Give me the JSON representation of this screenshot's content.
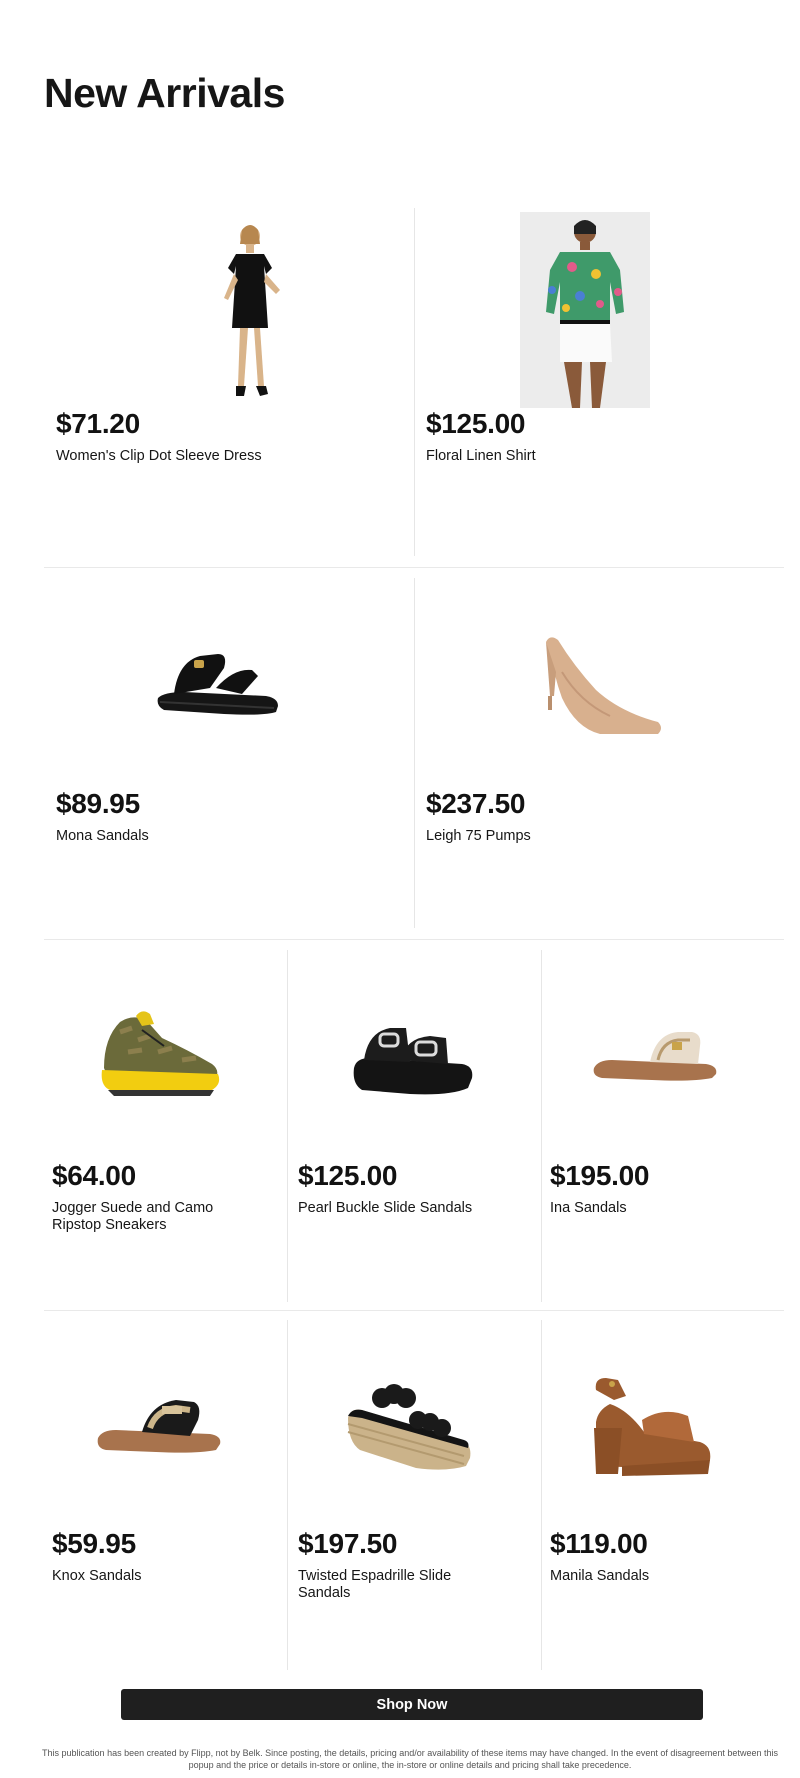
{
  "page": {
    "title": "New Arrivals"
  },
  "products": [
    {
      "price": "$71.20",
      "name": "Women's Clip Dot Sleeve Dress",
      "image": "black-dress-model"
    },
    {
      "price": "$125.00",
      "name": "Floral Linen Shirt",
      "image": "floral-shirt-model"
    },
    {
      "price": "$89.95",
      "name": "Mona Sandals",
      "image": "black-sport-sandal"
    },
    {
      "price": "$237.50",
      "name": "Leigh 75 Pumps",
      "image": "nude-pump"
    },
    {
      "price": "$64.00",
      "name": "Jogger Suede and Camo Ripstop Sneakers",
      "image": "camo-sneaker"
    },
    {
      "price": "$125.00",
      "name": "Pearl Buckle Slide Sandals",
      "image": "black-buckle-slide"
    },
    {
      "price": "$195.00",
      "name": "Ina Sandals",
      "image": "tan-flat-slide"
    },
    {
      "price": "$59.95",
      "name": "Knox Sandals",
      "image": "logo-strap-slide"
    },
    {
      "price": "$197.50",
      "name": "Twisted Espadrille Slide Sandals",
      "image": "espadrille-wedge"
    },
    {
      "price": "$119.00",
      "name": "Manila Sandals",
      "image": "brown-platform-heel"
    }
  ],
  "cta": {
    "label": "Shop Now"
  },
  "footer": {
    "disclaimer": "This publication has been created by Flipp, not by Belk. Since posting, the details, pricing and/or availability of these items may have changed. In the event of disagreement between this popup and the price or details in-store or online, the in-store or online details and pricing shall take precedence."
  }
}
